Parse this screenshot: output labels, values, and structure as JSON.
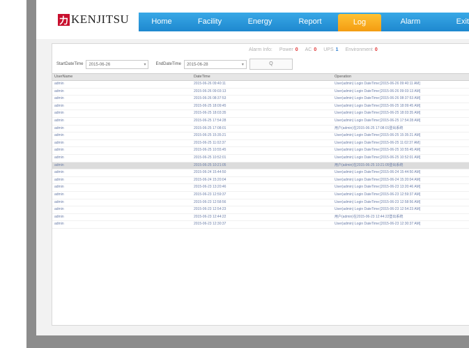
{
  "logo": {
    "mark": "力",
    "text": "KENJITSU"
  },
  "nav": [
    {
      "label": "Home",
      "active": false
    },
    {
      "label": "Facility",
      "active": false
    },
    {
      "label": "Energy",
      "active": false
    },
    {
      "label": "Report",
      "active": false
    },
    {
      "label": "Log",
      "active": true
    },
    {
      "label": "Alarm",
      "active": false
    },
    {
      "label": "Exit",
      "active": false
    }
  ],
  "alarm_info": {
    "label": "Alarm Info:",
    "items": [
      {
        "label": "Power",
        "count": "0"
      },
      {
        "label": "AC",
        "count": "0"
      },
      {
        "label": "UPS",
        "count": "1"
      },
      {
        "label": "Environment",
        "count": "0"
      }
    ]
  },
  "filter": {
    "start_label": "StartDateTime",
    "start_value": "2015-06-26",
    "end_label": "EndDateTime",
    "end_value": "2015-06-28",
    "query_label": "Q"
  },
  "table": {
    "headers": [
      "UserName",
      "DateTime",
      "Operation"
    ],
    "rows": [
      [
        "admin",
        "2015-06-26 09:40:11",
        "User(admin) Login DateTime:[2015-06-26 09:40:11 AM]"
      ],
      [
        "admin",
        "2015-06-26 09:03:13",
        "User(admin) Login DateTime:[2015-06-26 09:03:13 AM]"
      ],
      [
        "admin",
        "2015-06-26 08:37:53",
        "User(admin) Login DateTime:[2015-06-26 08:37:53 AM]"
      ],
      [
        "admin",
        "2015-06-25 18:09:45",
        "User(admin) Login DateTime:[2015-06-25 18:09:45 AM]"
      ],
      [
        "admin",
        "2015-06-25 18:03:35",
        "User(admin) Login DateTime:[2015-06-25 18:03:35 AM]"
      ],
      [
        "admin",
        "2015-06-25 17:54:28",
        "User(admin) Login DateTime:[2015-06-25 17:54:28 AM]"
      ],
      [
        "admin",
        "2015-06-25 17:08:01",
        "用户(admin)在2015-06-25 17:08:01登出系统"
      ],
      [
        "admin",
        "2015-06-25 15:35:21",
        "User(admin) Login DateTime:[2015-06-25 15:35:21 AM]"
      ],
      [
        "admin",
        "2015-06-25 11:02:37",
        "User(admin) Login DateTime:[2015-06-25 11:02:37 AM]"
      ],
      [
        "admin",
        "2015-06-25 10:55:45",
        "User(admin) Login DateTime:[2015-06-25 10:55:45 AM]"
      ],
      [
        "admin",
        "2015-06-25 10:52:01",
        "User(admin) Login DateTime:[2015-06-25 10:52:01 AM]"
      ],
      [
        "admin",
        "2015-06-25 10:21:05",
        "用户(admin)在2015-06-25 10:21:05登出系统"
      ],
      [
        "admin",
        "2015-06-24 15:44:50",
        "User(admin) Login DateTime:[2015-06-24 15:44:50 AM]"
      ],
      [
        "admin",
        "2015-06-24 15:20:04",
        "User(admin) Login DateTime:[2015-06-24 15:20:04 AM]"
      ],
      [
        "admin",
        "2015-06-23 13:20:46",
        "User(admin) Login DateTime:[2015-06-23 13:20:46 AM]"
      ],
      [
        "admin",
        "2015-06-23 12:59:37",
        "User(admin) Login DateTime:[2015-06-23 12:59:37 AM]"
      ],
      [
        "admin",
        "2015-06-23 12:58:56",
        "User(admin) Login DateTime:[2015-06-23 12:58:56 AM]"
      ],
      [
        "admin",
        "2015-06-23 12:54:23",
        "User(admin) Login DateTime:[2015-06-23 12:54:23 AM]"
      ],
      [
        "admin",
        "2015-06-23 12:44:22",
        "用户(admin)在2015-06-23 12:44:22登出系统"
      ],
      [
        "admin",
        "2015-06-23 12:30:37",
        "User(admin) Login DateTime:[2015-06-23 12:30:37 AM]"
      ]
    ],
    "selected_row": 11
  }
}
